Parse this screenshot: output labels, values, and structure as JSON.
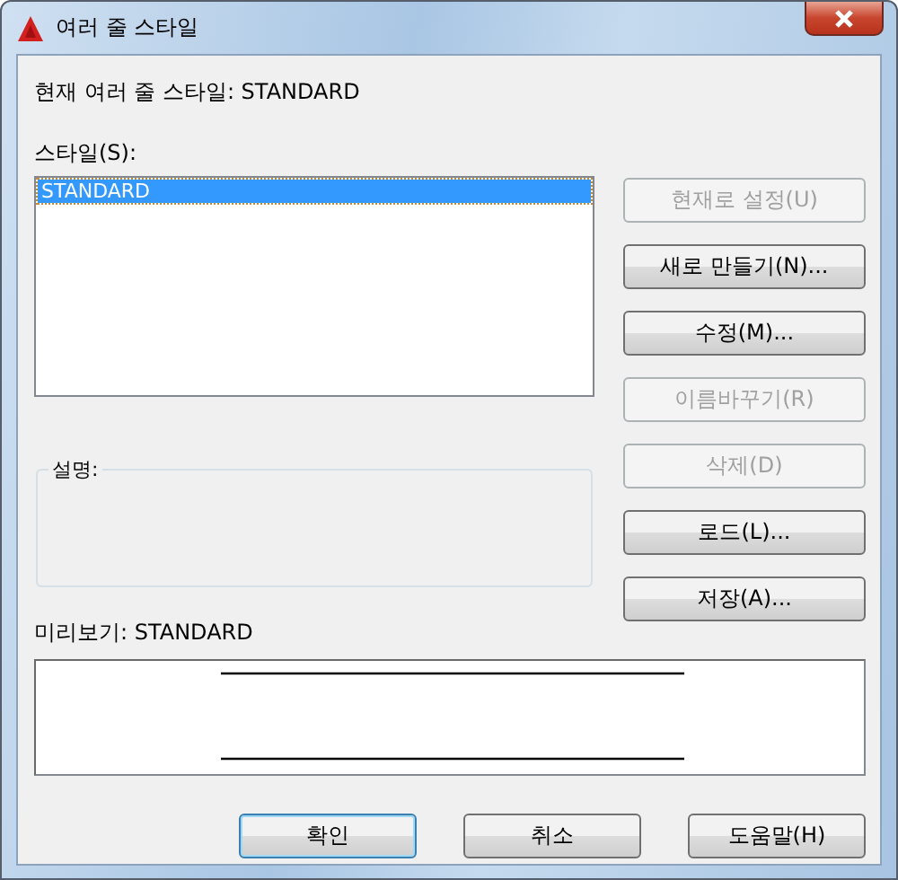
{
  "window": {
    "title": "여러 줄 스타일"
  },
  "current_style": "현재 여러 줄 스타일: STANDARD",
  "styles_label": "스타일(S):",
  "styles": [
    {
      "name": "STANDARD",
      "selected": true
    }
  ],
  "side_buttons": [
    {
      "label": "현재로 설정(U)",
      "disabled": true
    },
    {
      "label": "새로 만들기(N)...",
      "disabled": false
    },
    {
      "label": "수정(M)...",
      "disabled": false
    },
    {
      "label": "이름바꾸기(R)",
      "disabled": true
    },
    {
      "label": "삭제(D)",
      "disabled": true
    },
    {
      "label": "로드(L)...",
      "disabled": false
    },
    {
      "label": "저장(A)...",
      "disabled": false
    }
  ],
  "description_label": "설명:",
  "preview_label": "미리보기: STANDARD",
  "buttons": [
    {
      "label": "확인",
      "default": true
    },
    {
      "label": "취소",
      "default": false
    },
    {
      "label": "도움말(H)",
      "default": false
    }
  ]
}
